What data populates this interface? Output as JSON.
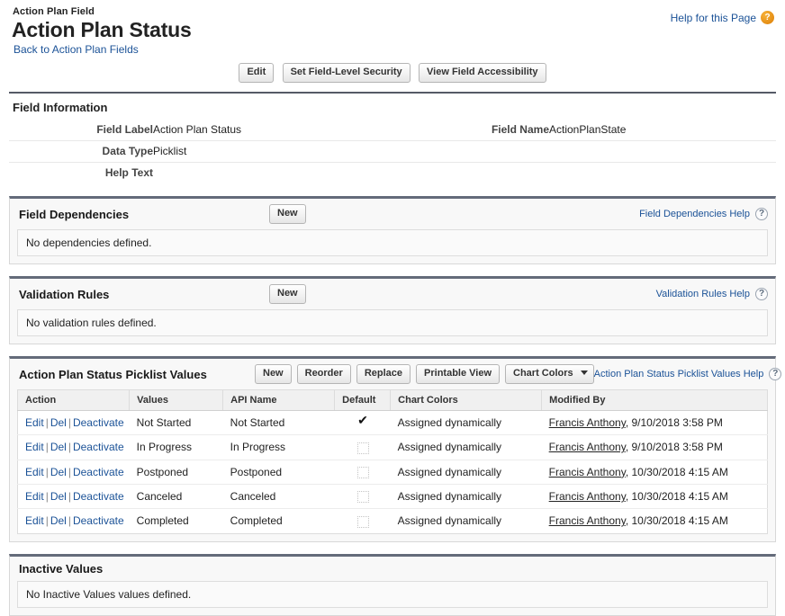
{
  "header": {
    "eyebrow": "Action Plan Field",
    "title": "Action Plan Status",
    "back_link": "Back to Action Plan Fields",
    "help_label": "Help for this Page",
    "help_icon": "help-question-orb-icon"
  },
  "toolbar": {
    "edit": "Edit",
    "field_level_security": "Set Field-Level Security",
    "field_accessibility": "View Field Accessibility"
  },
  "field_information": {
    "title": "Field Information",
    "rows": [
      {
        "label": "Field Label",
        "value": "Action Plan Status",
        "label2": "Field Name",
        "value2": "ActionPlanState"
      },
      {
        "label": "Data Type",
        "value": "Picklist",
        "label2": "",
        "value2": ""
      },
      {
        "label": "Help Text",
        "value": "",
        "label2": "",
        "value2": ""
      }
    ]
  },
  "field_dependencies": {
    "title": "Field Dependencies",
    "new_button": "New",
    "help_label": "Field Dependencies Help",
    "empty_message": "No dependencies defined."
  },
  "validation_rules": {
    "title": "Validation Rules",
    "new_button": "New",
    "help_label": "Validation Rules Help",
    "empty_message": "No validation rules defined."
  },
  "picklist": {
    "title": "Action Plan Status Picklist Values",
    "buttons": {
      "new": "New",
      "reorder": "Reorder",
      "replace": "Replace",
      "printable_view": "Printable View",
      "chart_colors": "Chart Colors"
    },
    "help_label": "Action Plan Status Picklist Values Help",
    "columns": [
      "Action",
      "Values",
      "API Name",
      "Default",
      "Chart Colors",
      "Modified By"
    ],
    "row_actions": {
      "edit": "Edit",
      "del": "Del",
      "deactivate": "Deactivate"
    },
    "rows": [
      {
        "value": "Not Started",
        "api_name": "Not Started",
        "default": true,
        "chart_colors": "Assigned dynamically",
        "modified_user": "Francis Anthony",
        "modified_when": ", 9/10/2018 3:58 PM"
      },
      {
        "value": "In Progress",
        "api_name": "In Progress",
        "default": false,
        "chart_colors": "Assigned dynamically",
        "modified_user": "Francis Anthony",
        "modified_when": ", 9/10/2018 3:58 PM"
      },
      {
        "value": "Postponed",
        "api_name": "Postponed",
        "default": false,
        "chart_colors": "Assigned dynamically",
        "modified_user": "Francis Anthony",
        "modified_when": ", 10/30/2018 4:15 AM"
      },
      {
        "value": "Canceled",
        "api_name": "Canceled",
        "default": false,
        "chart_colors": "Assigned dynamically",
        "modified_user": "Francis Anthony",
        "modified_when": ", 10/30/2018 4:15 AM"
      },
      {
        "value": "Completed",
        "api_name": "Completed",
        "default": false,
        "chart_colors": "Assigned dynamically",
        "modified_user": "Francis Anthony",
        "modified_when": ", 10/30/2018 4:15 AM"
      }
    ]
  },
  "inactive_values": {
    "title": "Inactive Values",
    "empty_message": "No Inactive Values values defined."
  },
  "icons": {
    "help_question": "?",
    "dropdown_caret": "chevron-down-icon",
    "checkmark": "✔"
  },
  "colors": {
    "link": "#1b5297",
    "section_bar": "#646b7a",
    "help_orb": "#e38b12"
  }
}
